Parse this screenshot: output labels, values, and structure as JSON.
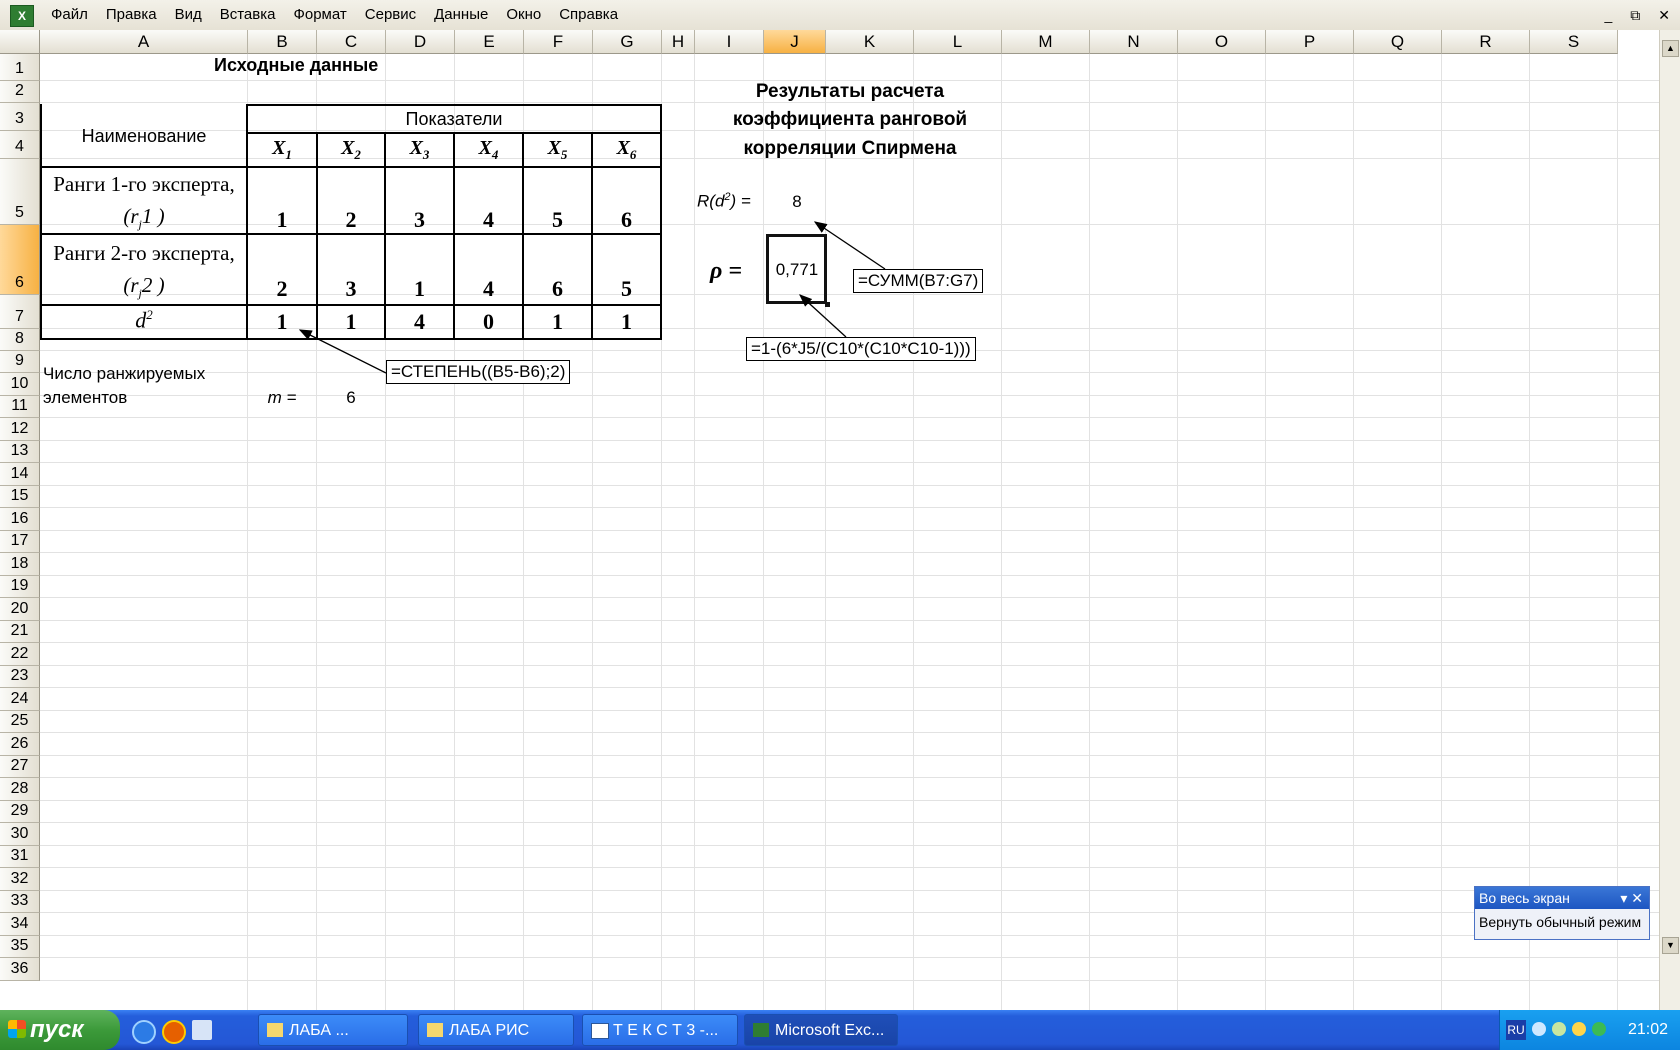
{
  "menu": {
    "items": [
      "Файл",
      "Правка",
      "Вид",
      "Вставка",
      "Формат",
      "Сервис",
      "Данные",
      "Окно",
      "Справка"
    ],
    "window_controls": [
      "_",
      "⧉",
      "✕"
    ]
  },
  "sheet": {
    "selected_column": "J",
    "selected_row": "6",
    "title_left": "Исходные данные",
    "header_name": "Наименование",
    "header_indicators": "Показатели",
    "x_labels": [
      "X",
      "X",
      "X",
      "X",
      "X",
      "X"
    ],
    "x_subs": [
      "1",
      "2",
      "3",
      "4",
      "5",
      "6"
    ],
    "row5_label_line1": "Ранги 1-го эксперта,",
    "row5_label_line2_a": "(r",
    "row5_label_line2_sub": "j",
    "row5_label_line2_b": "1 )",
    "row6_label_line1": "Ранги 2-го эксперта,",
    "row6_label_line2_a": "(r",
    "row6_label_line2_sub": "j",
    "row6_label_line2_b": "2 )",
    "row7_label": "d",
    "row7_label_sup": "2",
    "ranks1": [
      "1",
      "2",
      "3",
      "4",
      "5",
      "6"
    ],
    "ranks2": [
      "2",
      "3",
      "1",
      "4",
      "6",
      "5"
    ],
    "d2": [
      "1",
      "1",
      "4",
      "0",
      "1",
      "1"
    ],
    "count_label_line1": "Число ранжируемых",
    "count_label_line2": "элементов",
    "m_label": "m =",
    "m_value": "6",
    "formula_power": "=СТЕПЕНЬ((B5-B6);2)",
    "results_title_line1": "Результаты расчета",
    "results_title_line2": "коэффициента ранговой",
    "results_title_line3": "корреляции Спирмена",
    "r_label_a": "R(d",
    "r_label_sup": "2",
    "r_label_b": ") =",
    "r_value": "8",
    "rho_label": "ρ =",
    "rho_value": "0,771",
    "formula_sum": "=СУММ(B7:G7)",
    "formula_rho": "=1-(6*J5/(C10*(C10*C10-1)))"
  },
  "columns": [
    "A",
    "B",
    "C",
    "D",
    "E",
    "F",
    "G",
    "H",
    "I",
    "J",
    "K",
    "L",
    "M",
    "N",
    "O",
    "P",
    "Q",
    "R",
    "S"
  ],
  "rows": [
    "1",
    "2",
    "3",
    "4",
    "5",
    "6",
    "7",
    "8",
    "9",
    "10",
    "11",
    "12",
    "13",
    "14",
    "15",
    "16",
    "17",
    "18",
    "19",
    "20",
    "21",
    "22",
    "23",
    "24",
    "25",
    "26",
    "27",
    "28",
    "29",
    "30",
    "31",
    "32",
    "33",
    "34",
    "35",
    "36"
  ],
  "fullscreen_panel": {
    "title": "Во весь экран",
    "action": "Вернуть обычный режим"
  },
  "taskbar": {
    "start_label": "пуск",
    "buttons": [
      "ЛАБА          ...",
      "ЛАБА РИС",
      "Т Е К С Т 3 -...",
      "Microsoft Exc..."
    ],
    "lang": "RU",
    "clock": "21:02"
  },
  "colors": {
    "selection": "#f7b143",
    "taskbar": "#245edb",
    "start": "#3c9a3a"
  }
}
